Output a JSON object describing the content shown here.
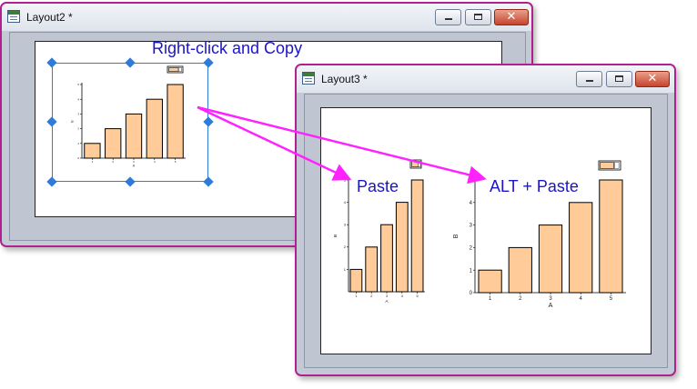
{
  "windows": {
    "layout2": {
      "title": "Layout2 *",
      "close_glyph": "✕"
    },
    "layout3": {
      "title": "Layout3 *",
      "close_glyph": "✕"
    }
  },
  "captions": {
    "copy": "Right-click and Copy",
    "paste": "Paste",
    "alt_paste": "ALT + Paste"
  },
  "colors": {
    "window_frame": "#b0208e",
    "bar_fill": "#ffcc99",
    "arrow": "#ff22ff",
    "caption_text": "#1b14c9",
    "selection": "#2f7cd8"
  },
  "chart_data": [
    {
      "id": "layout2-graph",
      "type": "bar",
      "categories": [
        "1",
        "2",
        "3",
        "4",
        "5"
      ],
      "values": [
        1,
        2,
        3,
        4,
        5
      ],
      "ylim": [
        0,
        5
      ],
      "yticks": [
        "0",
        "1",
        "2",
        "3",
        "4",
        "5"
      ],
      "xlabel": "A",
      "ylabel": "B",
      "legend_placement": "top-right",
      "selected": true
    },
    {
      "id": "layout3-paste-graph",
      "type": "bar",
      "categories": [
        "1",
        "2",
        "3",
        "4",
        "5"
      ],
      "values": [
        1,
        2,
        3,
        4,
        5
      ],
      "ylim": [
        0,
        5
      ],
      "yticks": [
        "1",
        "2",
        "3",
        "4",
        "5"
      ],
      "xlabel": "A",
      "ylabel": "B",
      "legend_placement": "top-right",
      "selected": false
    },
    {
      "id": "layout3-alt-paste-graph",
      "type": "bar",
      "categories": [
        "1",
        "2",
        "3",
        "4",
        "5"
      ],
      "values": [
        1,
        2,
        3,
        4,
        5
      ],
      "ylim": [
        0,
        5
      ],
      "yticks": [
        "0",
        "1",
        "2",
        "3",
        "4",
        "5"
      ],
      "xlabel": "A",
      "ylabel": "B",
      "legend_placement": "top-right",
      "selected": false
    }
  ]
}
